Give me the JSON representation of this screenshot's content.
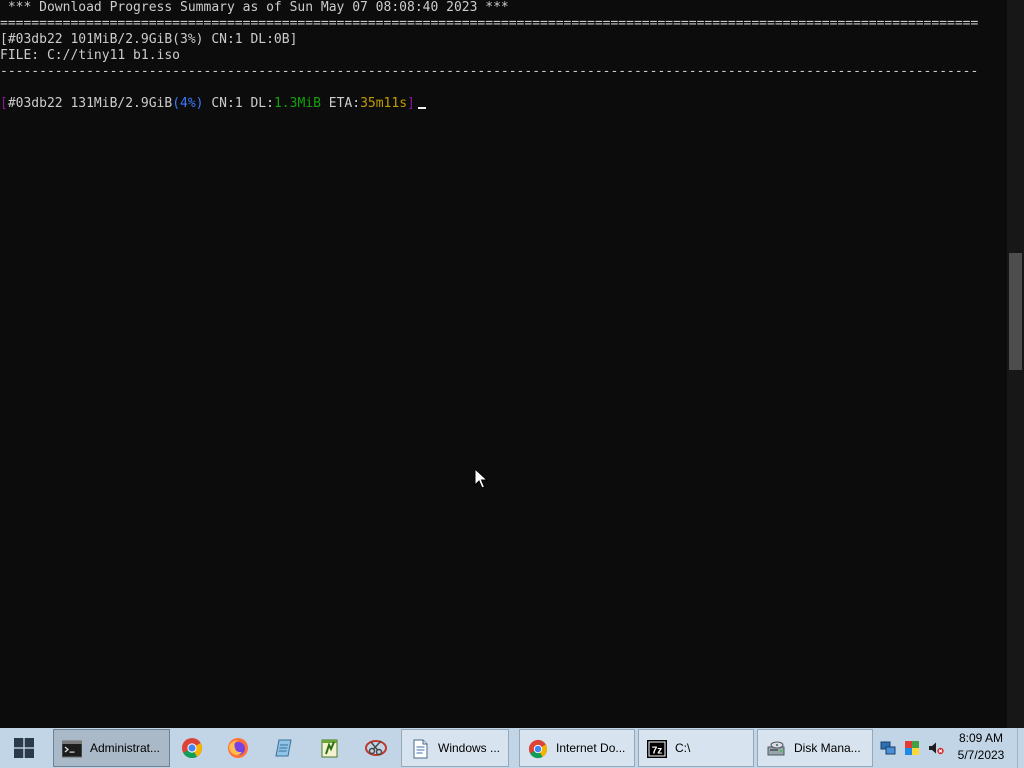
{
  "console": {
    "summary_header": " *** Download Progress Summary as of Sun May 07 08:08:40 2023 ***",
    "separator_double": "=============================================================================================================================",
    "progress_line": "[#03db22 101MiB/2.9GiB(3%) CN:1 DL:0B]",
    "file_line": "FILE: C://tiny11 b1.iso",
    "separator_single": "-----------------------------------------------------------------------------------------------------------------------------",
    "live_status": {
      "open_bracket": "[",
      "gid_size": "#03db22 131MiB/2.9GiB",
      "percent": "(4%)",
      "connections": " CN:1 DL:",
      "speed": "1.3MiB",
      "eta_label": " ETA:",
      "eta": "35m11s",
      "close_bracket": "]"
    }
  },
  "taskbar": {
    "buttons": [
      {
        "label": "Administrat...",
        "icon": "command-prompt-icon",
        "active": true
      },
      {
        "label": "Windows ...",
        "icon": "document-icon"
      },
      {
        "label": "Internet Do...",
        "icon": "chrome-icon"
      },
      {
        "label": "C:\\",
        "icon": "7zip-icon",
        "icon_text": "7z"
      },
      {
        "label": "Disk Mana...",
        "icon": "disk-management-icon"
      }
    ],
    "pinned": [
      "chrome-icon",
      "firefox-icon",
      "notepad-icon",
      "notepad-plus-plus-icon",
      "snipping-tool-icon"
    ],
    "tray": [
      "network-icon",
      "color-icon",
      "volume-muted-icon"
    ],
    "clock": {
      "time": "8:09 AM",
      "date": "5/7/2023"
    }
  },
  "colors": {
    "console_bg": "#0c0c0c",
    "console_text": "#cccccc",
    "bracket_magenta": "#881798",
    "percent_blue": "#3b78ff",
    "speed_green": "#13a10e",
    "eta_yellow": "#c19c00",
    "taskbar_bg": "#c2d5e6"
  }
}
